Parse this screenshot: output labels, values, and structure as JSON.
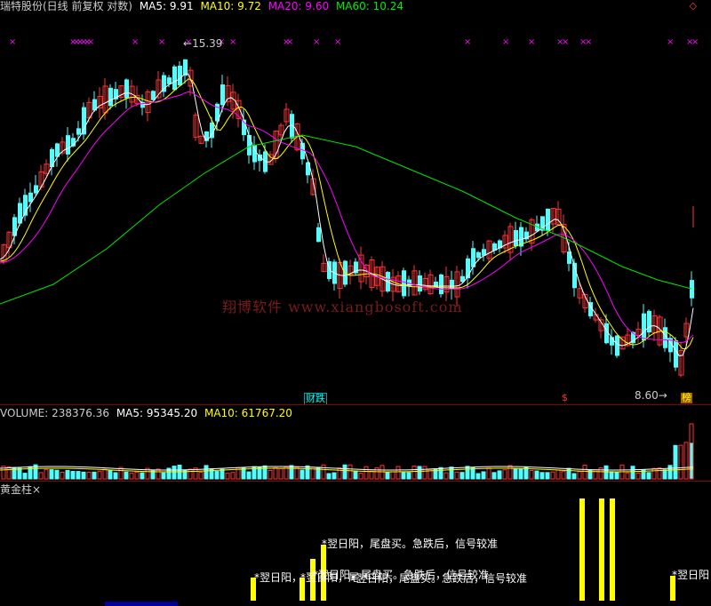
{
  "price_header": {
    "title": "瑞特股份(日线 前复权 对数)",
    "ma5": "MA5: 9.91",
    "ma10": "MA10: 9.72",
    "ma20": "MA20: 9.60",
    "ma60": "MA60: 10.24"
  },
  "price_annotations": {
    "high_label": "15.39",
    "low_label": "8.60",
    "badge_finance": "财跌",
    "badge_dollar": "$",
    "badge_rank": "榜"
  },
  "watermark": "翔博软件 www.xiangbosoft.com",
  "volume_header": {
    "title": "VOLUME: 238376.36",
    "ma5": "MA5: 95345.20",
    "ma10": "MA10: 61767.20"
  },
  "indicator_header": {
    "title": "黄金柱",
    "close": "×"
  },
  "indicator_texts": {
    "signal_a": "*翌日阳，尾盘买。急跌后，信号较准",
    "signal_b": "*翌日阳，尾盘买。急跌后，信号较准",
    "signal_c": "*翌日阳，",
    "signal_d": "*翌日阳，尾",
    "signal_e": "*翌日阳，尾盘买。急跌后，信号较准",
    "signal_f": "*翌日阳"
  },
  "colors": {
    "up": "#ff3232",
    "down": "#54fcfc",
    "ma5": "#ffffff",
    "ma10": "#ffff00",
    "ma20": "#ff00ff",
    "ma60": "#00e600",
    "golden_bar": "#ffff00",
    "marker": "#ff00ff"
  }
}
